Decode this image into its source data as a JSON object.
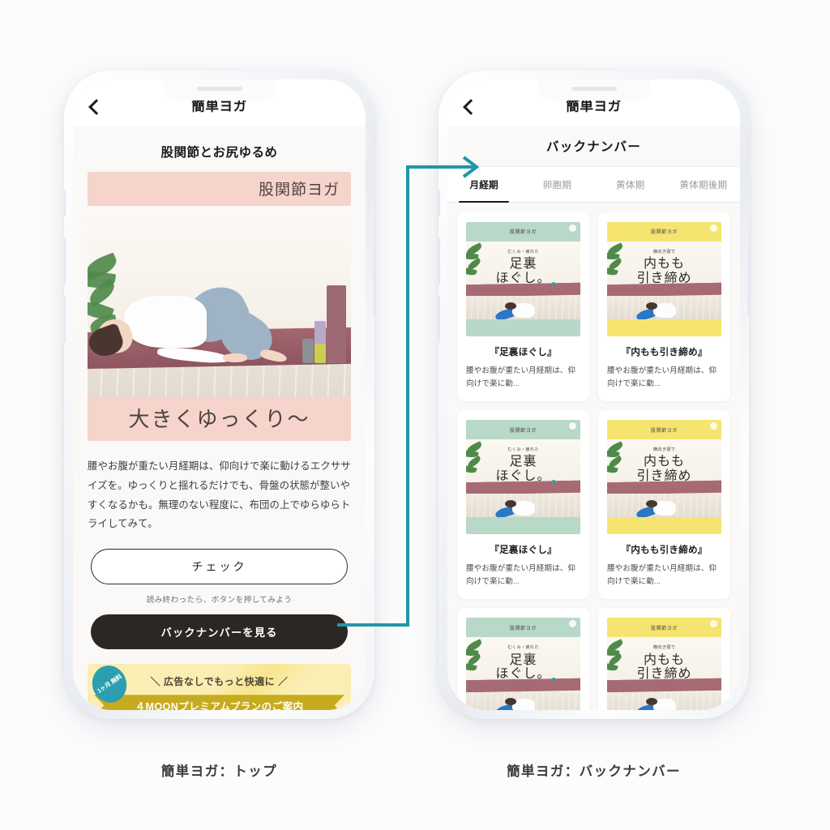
{
  "screens": {
    "left": {
      "caption": "簡単ヨガ：トップ",
      "nav": {
        "title": "簡単ヨガ",
        "back_icon": "back-chevron-icon"
      },
      "article": {
        "title": "股関節とお尻ゆるめ",
        "hero": {
          "top_label": "股関節ヨガ",
          "bottom_label": "大きくゆっくり〜"
        },
        "body": "腰やお腹が重たい月経期は、仰向けで楽に動けるエクササイズを。ゆっくりと揺れるだけでも、骨盤の状態が整いやすくなるかも。無理のない程度に、布団の上でゆらゆらトライしてみて。",
        "check_button": "チェック",
        "check_hint": "読み終わったら、ボタンを押してみよう",
        "backnumber_button": "バックナンバーを見る"
      },
      "promo": {
        "badge": "1ヶ月\n無料",
        "line1": "＼ 広告なしでもっと快適に ／",
        "line2": "４MOONプレミアムプランのご案内"
      }
    },
    "right": {
      "caption": "簡単ヨガ：バックナンバー",
      "nav": {
        "title": "簡単ヨガ",
        "back_icon": "back-chevron-icon"
      },
      "subheader": "バックナンバー",
      "tabs": [
        {
          "label": "月経期",
          "active": true
        },
        {
          "label": "卵胞期",
          "active": false
        },
        {
          "label": "黄体期",
          "active": false
        },
        {
          "label": "黄体期後期",
          "active": false
        }
      ],
      "cards": [
        {
          "thumb_band": "股関節ヨガ",
          "thumb_sub": "むくみ・疲れた",
          "thumb_title": "足裏\nほぐし。",
          "theme": "green",
          "title": "『足裏ほぐし』",
          "desc": "腰やお腹が重たい月経期は、仰向けで楽に動..."
        },
        {
          "thumb_band": "股関節ヨガ",
          "thumb_sub": "横向き寝で",
          "thumb_title": "内もも\n引き締め",
          "theme": "yellow",
          "title": "『内もも引き締め』",
          "desc": "腰やお腹が重たい月経期は、仰向けで楽に動..."
        },
        {
          "thumb_band": "股関節ヨガ",
          "thumb_sub": "むくみ・疲れた",
          "thumb_title": "足裏\nほぐし。",
          "theme": "green",
          "title": "『足裏ほぐし』",
          "desc": "腰やお腹が重たい月経期は、仰向けで楽に動..."
        },
        {
          "thumb_band": "股関節ヨガ",
          "thumb_sub": "横向き寝で",
          "thumb_title": "内もも\n引き締め",
          "theme": "yellow",
          "title": "『内もも引き締め』",
          "desc": "腰やお腹が重たい月経期は、仰向けで楽に動..."
        },
        {
          "thumb_band": "股関節ヨガ",
          "thumb_sub": "むくみ・疲れた",
          "thumb_title": "足裏\nほぐし。",
          "theme": "green",
          "title": "",
          "desc": ""
        },
        {
          "thumb_band": "股関節ヨガ",
          "thumb_sub": "横向き寝で",
          "thumb_title": "内もも\n引き締め",
          "theme": "yellow",
          "title": "",
          "desc": ""
        }
      ]
    }
  },
  "colors": {
    "connector": "#2196a8",
    "hero_band": "#f6d3cb",
    "cta_dark": "#2a2724",
    "promo_yellow": "#fbeeb4",
    "promo_ribbon": "#c7ab1f",
    "badge_teal": "#2b9fb0",
    "background": "#fcfcfd",
    "screen_bg": "#faf9f7"
  }
}
